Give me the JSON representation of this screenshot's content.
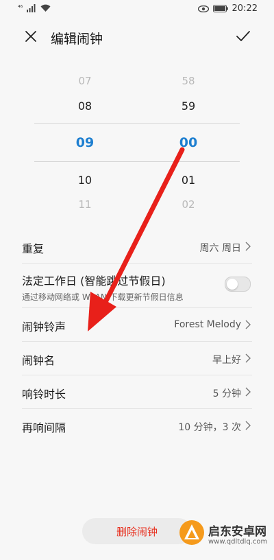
{
  "status_bar": {
    "signal": "⁴⁶",
    "time": "20:22"
  },
  "header": {
    "title": "编辑闹钟"
  },
  "picker": {
    "hours": [
      "07",
      "08",
      "09",
      "10",
      "11"
    ],
    "minutes": [
      "58",
      "59",
      "00",
      "01",
      "02"
    ],
    "selected_hour": "09",
    "selected_minute": "00"
  },
  "settings": {
    "repeat": {
      "label": "重复",
      "value": "周六 周日"
    },
    "workday": {
      "label": "法定工作日 (智能跳过节假日)",
      "sub": "通过移动网络或 WLAN 下载更新节假日信息",
      "enabled": false
    },
    "ringtone": {
      "label": "闹钟铃声",
      "value": "Forest Melody"
    },
    "name": {
      "label": "闹钟名",
      "value": "早上好"
    },
    "duration": {
      "label": "响铃时长",
      "value": "5 分钟"
    },
    "snooze": {
      "label": "再响间隔",
      "value": "10 分钟，3 次"
    }
  },
  "delete_label": "删除闹钟",
  "watermark": {
    "name": "启东安卓网",
    "url": "www.qdltdlq.com"
  },
  "colors": {
    "accent": "#1e7fd0",
    "delete": "#e8301f",
    "annotation_arrow": "#e8201a"
  }
}
